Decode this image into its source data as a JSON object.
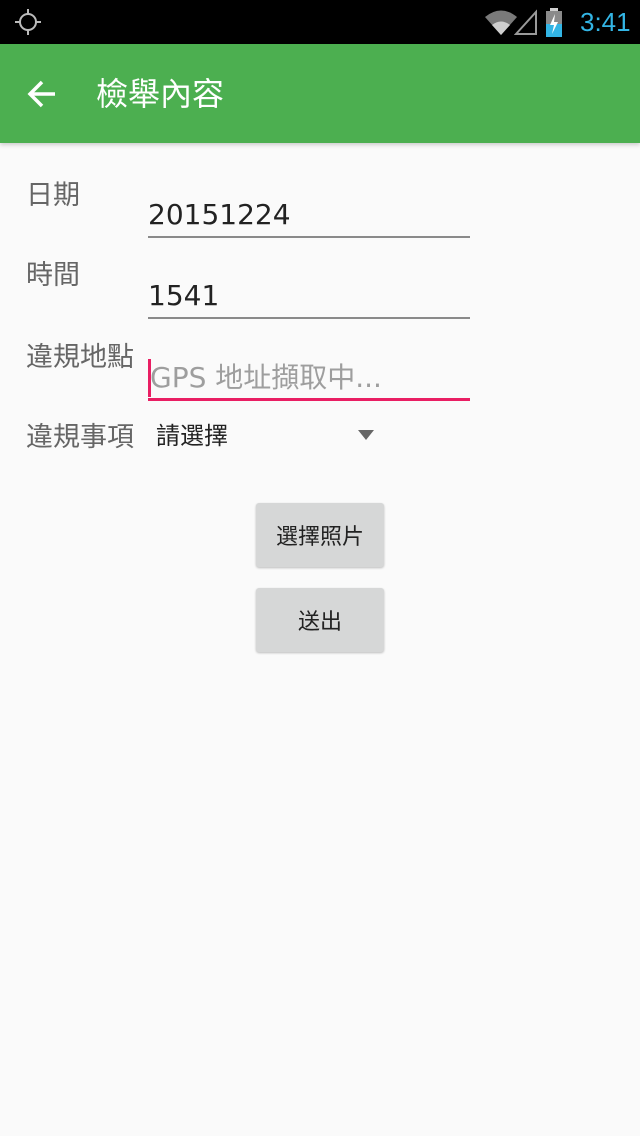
{
  "status_bar": {
    "time": "3:41",
    "icons": [
      "gps-icon",
      "wifi-icon",
      "cell-signal-icon",
      "battery-charging-icon"
    ],
    "time_color": "#33b5e5"
  },
  "toolbar": {
    "title": "檢舉內容",
    "back_icon": "arrow-back-icon",
    "background": "#4caf50"
  },
  "form": {
    "date_label": "日期",
    "date_value": "20151224",
    "time_label": "時間",
    "time_value": "1541",
    "location_label": "違規地點",
    "location_placeholder": "GPS 地址擷取中...",
    "violation_label": "違規事項",
    "violation_selected": "請選擇",
    "accent_color": "#e91e63"
  },
  "buttons": {
    "choose_photo": "選擇照片",
    "submit": "送出"
  }
}
